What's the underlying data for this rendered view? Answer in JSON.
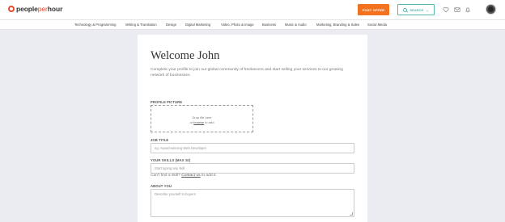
{
  "header": {
    "logo_part1": "people",
    "logo_part2": "per",
    "logo_part3": "hour",
    "post_offer_label": "POST OFFER",
    "search_label": "SEARCH",
    "icons": [
      "heart-icon",
      "mail-icon",
      "bell-icon"
    ]
  },
  "categories": [
    "Technology & Programming",
    "Writing & Translation",
    "Design",
    "Digital Marketing",
    "Video, Photo & Image",
    "Business",
    "Music & Audio",
    "Marketing, Branding & Sales",
    "Social Media"
  ],
  "form": {
    "title": "Welcome John",
    "intro": "Complete your profile to join our global community of freelancers and start selling your services to our growing network of businesses.",
    "profile_picture_label": "PROFILE PICTURE",
    "drop_text": "Drop file here",
    "or_text": "or",
    "browse_text": "browse",
    "to_add_text": "to add",
    "job_title_label": "JOB TITLE",
    "job_title_placeholder": "eg. Award-winning Web Developer",
    "skills_label": "YOUR SKILLS (MAX 10)",
    "skills_placeholder": "Start typing any skill",
    "skill_help_prefix": "Can't find a skill?",
    "contact_link": "Contact us",
    "skill_help_suffix": "to add it.",
    "about_label": "ABOUT YOU",
    "about_placeholder": "Describe yourself to buyers"
  },
  "colors": {
    "brand_orange": "#f3721f",
    "logo_red": "#e84b2a",
    "search_teal": "#58b7b0",
    "page_bg": "#eaecf2"
  }
}
